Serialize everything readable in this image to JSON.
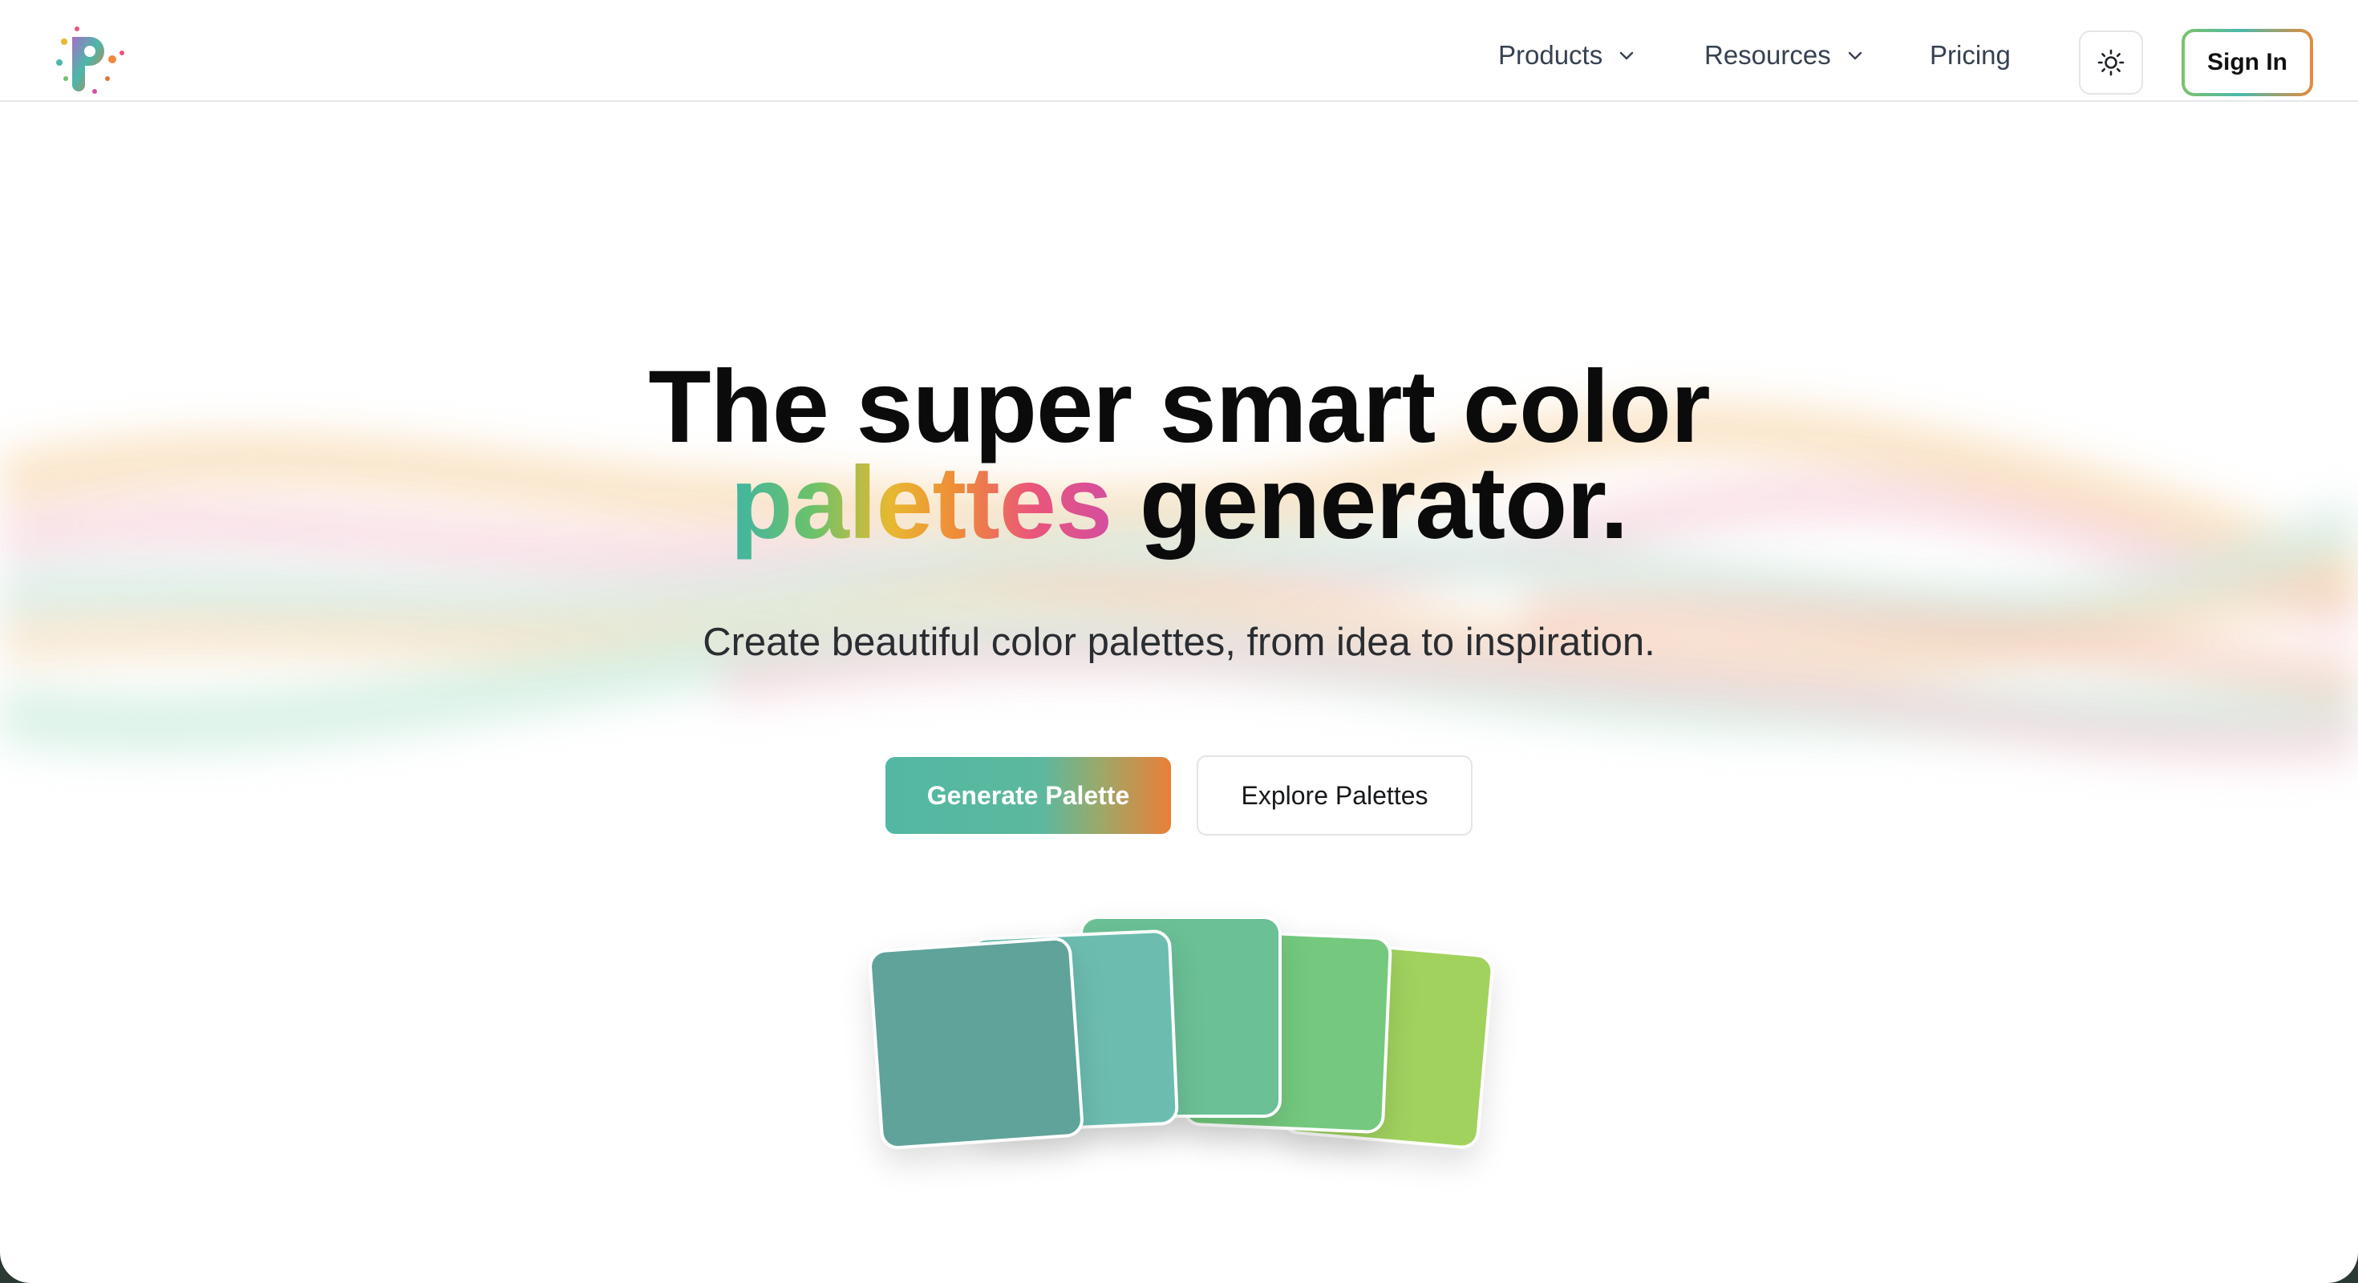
{
  "header": {
    "logo_alt": "Palette logo",
    "nav": [
      {
        "label": "Products",
        "has_dropdown": true
      },
      {
        "label": "Resources",
        "has_dropdown": true
      },
      {
        "label": "Pricing",
        "has_dropdown": false
      }
    ],
    "theme_toggle_icon": "sun-icon",
    "sign_in_label": "Sign In"
  },
  "hero": {
    "title_line1": "The super smart color",
    "title_accent": "palettes",
    "title_line2_rest": " generator.",
    "subtitle": "Create beautiful color palettes, from idea to inspiration.",
    "primary_cta": "Generate Palette",
    "secondary_cta": "Explore Palettes"
  },
  "palette_cards": [
    {
      "color": "#a1d25e"
    },
    {
      "color": "#74c97e"
    },
    {
      "color": "#6bc096"
    },
    {
      "color": "#6cbdb0"
    },
    {
      "color": "#5fa39a"
    }
  ],
  "colors": {
    "teal": "#4bb8a9",
    "green": "#6cc26a",
    "yellow": "#e8b830",
    "orange": "#ef8a3a",
    "pink": "#e9557c",
    "magenta": "#d44ea0"
  }
}
